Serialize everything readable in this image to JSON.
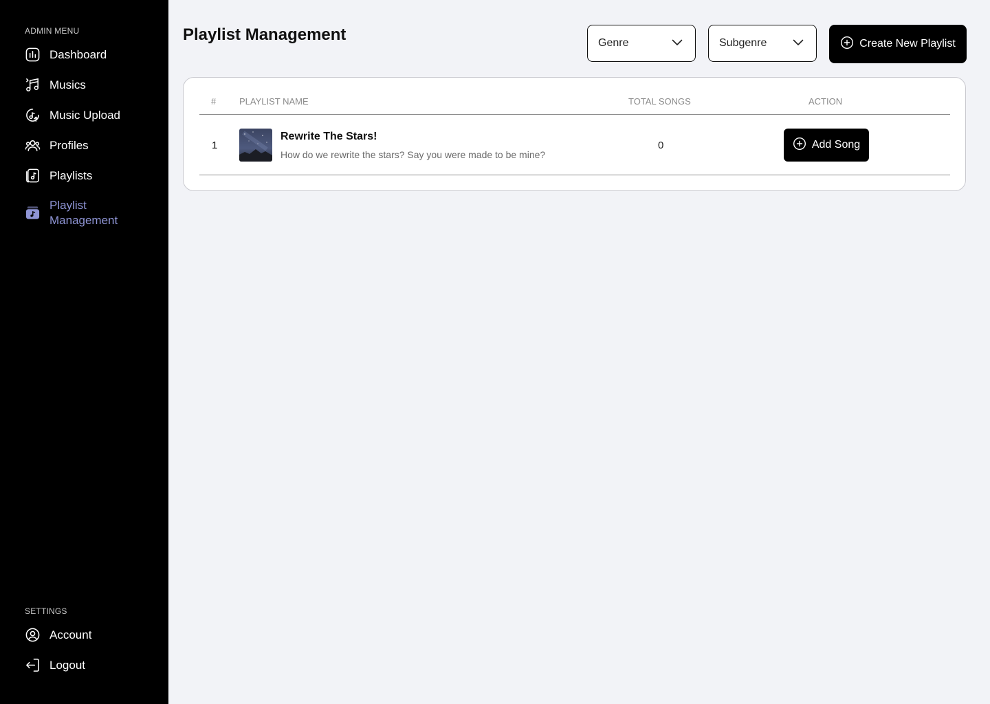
{
  "sidebar": {
    "admin_label": "ADMIN MENU",
    "items": [
      {
        "label": "Dashboard",
        "icon": "chart-icon"
      },
      {
        "label": "Musics",
        "icon": "music-notes-icon"
      },
      {
        "label": "Music Upload",
        "icon": "music-upload-icon"
      },
      {
        "label": "Profiles",
        "icon": "users-icon"
      },
      {
        "label": "Playlists",
        "icon": "playlist-icon"
      },
      {
        "label": "Playlist Management",
        "icon": "playlist-management-icon",
        "active": true
      }
    ],
    "settings_label": "SETTINGS",
    "settings_items": [
      {
        "label": "Account",
        "icon": "account-icon"
      },
      {
        "label": "Logout",
        "icon": "logout-icon"
      }
    ]
  },
  "header": {
    "title": "Playlist Management",
    "genre_select": "Genre",
    "subgenre_select": "Subgenre",
    "create_button": "Create New Playlist"
  },
  "table": {
    "columns": [
      "#",
      "PLAYLIST NAME",
      "TOTAL SONGS",
      "ACTION"
    ],
    "rows": [
      {
        "index": "1",
        "name": "Rewrite The Stars!",
        "description": "How do we rewrite the stars? Say you were made to be mine?",
        "total_songs": "0",
        "action": "Add Song"
      }
    ]
  },
  "colors": {
    "sidebar_bg": "#000000",
    "page_bg": "#f2f3f7",
    "active_accent": "#8f95d6",
    "button_bg": "#000000"
  }
}
